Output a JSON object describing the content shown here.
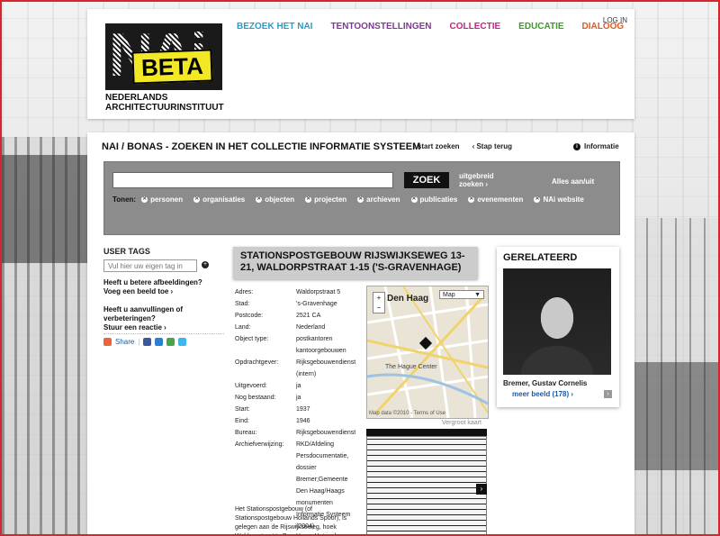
{
  "header": {
    "logo_word": "NAi",
    "logo_badge": "BETA",
    "logo_sub_line1": "NEDERLANDS",
    "logo_sub_line2": "ARCHITECTUURINSTITUUT",
    "login": "LOG IN",
    "nav": [
      {
        "label": "BEZOEK HET NAI",
        "color": "#2a9bc4"
      },
      {
        "label": "TENTOONSTELLINGEN",
        "color": "#7b3b8f"
      },
      {
        "label": "COLLECTIE",
        "color": "#c4257e"
      },
      {
        "label": "EDUCATIE",
        "color": "#3f9a2c"
      },
      {
        "label": "DIALOOG",
        "color": "#e05a22"
      }
    ]
  },
  "breadcrumb": {
    "title": "NAI / BONAS - ZOEKEN IN HET COLLECTIE INFORMATIE SYSTEEM",
    "start": "‹ start zoeken",
    "back": "‹ Stap terug",
    "info": "Informatie"
  },
  "search": {
    "placeholder": "",
    "button": "ZOEK",
    "advanced_line1": "uitgebreid",
    "advanced_line2": "zoeken ›",
    "toggle_all": "Alles aan/uit",
    "show_label": "Tonen:",
    "options": [
      "personen",
      "organisaties",
      "objecten",
      "projecten",
      "archieven",
      "publicaties",
      "evenementen",
      "NAi website"
    ]
  },
  "sidebar": {
    "user_tags_title": "USER TAGS",
    "tag_placeholder": "Vul hier uw eigen tag in",
    "images_line1": "Heeft u betere afbeeldingen?",
    "images_line2": "Voeg een beeld toe ›",
    "additions_line1": "Heeft u aanvullingen of",
    "additions_line2": "verbeteringen?",
    "additions_line3": "Stuur een reactie ›",
    "share": "Share"
  },
  "object": {
    "title": "STATIONSPOSTGEBOUW RIJSWIJKSEWEG 13-21, WALDORPSTRAAT 1-15 ('S-GRAVENHAGE)",
    "properties": [
      {
        "label": "Adres:",
        "value": "Waldorpstraat 5"
      },
      {
        "label": "Stad:",
        "value": "'s-Gravenhage"
      },
      {
        "label": "Postcode:",
        "value": "2521 CA"
      },
      {
        "label": "Land:",
        "value": "Nederland"
      },
      {
        "label": "Object type:",
        "value": "postkantoren"
      },
      {
        "label": "",
        "value": "kantoorgebouwen"
      },
      {
        "label": "Opdrachtgever:",
        "value": "Rijksgebouwendienst"
      },
      {
        "label": "",
        "value": "(intern)"
      },
      {
        "label": "Uitgevoerd:",
        "value": "ja"
      },
      {
        "label": "Nog bestaand:",
        "value": "ja"
      },
      {
        "label": "Start:",
        "value": "1937"
      },
      {
        "label": "Eind:",
        "value": "1946"
      },
      {
        "label": "Bureau:",
        "value": "Rijksgebouwendienst"
      },
      {
        "label": "Archiefverwijzing:",
        "value": "RKD/Afdeling"
      },
      {
        "label": "",
        "value": "Persdocumentatie,"
      },
      {
        "label": "",
        "value": "dossier"
      },
      {
        "label": "",
        "value": "Bremer;Gemeente"
      },
      {
        "label": "",
        "value": "Den Haag/Haags"
      },
      {
        "label": "",
        "value": "monumenten"
      },
      {
        "label": "",
        "value": "Informatie Systeem"
      },
      {
        "label": "",
        "value": "(2004)"
      }
    ],
    "description": "Het Stationspostgebouw (of Stationspostgebouw Hollands Spoor), is gelegen aan de Rijswijkseweg, hoek Waldorpstraat te Den Haag. Het is de"
  },
  "map": {
    "type_label": "Map",
    "city": "Den Haag",
    "place_label": "The Hague Center",
    "footer": "Map data ©2010 - Terms of Use",
    "enlarge": "Vergroot kaart"
  },
  "related": {
    "title": "GERELATEERD",
    "name": "Bremer, Gustav Cornelis",
    "more": "meer beeld (178) ›"
  }
}
